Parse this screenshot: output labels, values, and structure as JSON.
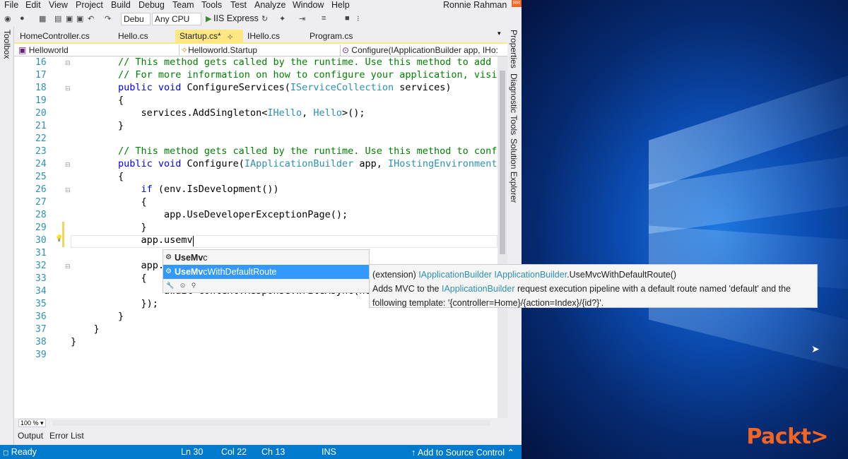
{
  "menu": [
    "File",
    "Edit",
    "View",
    "Project",
    "Build",
    "Debug",
    "Team",
    "Tools",
    "Test",
    "Analyze",
    "Window",
    "Help"
  ],
  "user": {
    "name": "Ronnie Rahman",
    "badge": "RR"
  },
  "toolbar": {
    "config": "Debu",
    "platform": "Any CPU",
    "run": "IIS Express"
  },
  "side_left": "Toolbox",
  "side_right": [
    "Properties",
    "Diagnostic Tools",
    "Solution Explorer"
  ],
  "tabs": [
    {
      "label": "HomeController.cs"
    },
    {
      "label": "Hello.cs"
    },
    {
      "label": "Startup.cs*",
      "active": true
    },
    {
      "label": "IHello.cs"
    },
    {
      "label": "Program.cs"
    }
  ],
  "nav": {
    "project": "Helloworld",
    "class": "Helloworld.Startup",
    "member": "Configure(IApplicationBuilder app, IHo:"
  },
  "lines": [
    "16",
    "17",
    "18",
    "19",
    "20",
    "21",
    "22",
    "23",
    "24",
    "25",
    "26",
    "27",
    "28",
    "29",
    "30",
    "31",
    "32",
    "33",
    "34",
    "35",
    "36",
    "37",
    "38",
    "39"
  ],
  "code": {
    "l16": "// This method gets called by the runtime. Use this method to add",
    "l17": "// For more information on how to configure your application, visi",
    "l18_kw": "public void ",
    "l18_fn": "ConfigureServices(",
    "l18_ty": "IServiceCollection",
    "l18_end": " services)",
    "l19": "{",
    "l20_a": "    services.AddSingleton<",
    "l20_t1": "IHello",
    "l20_b": ", ",
    "l20_t2": "Hello",
    "l20_c": ">();",
    "l21": "}",
    "l23": "// This method gets called by the runtime. Use this method to conf",
    "l24_kw": "public void ",
    "l24_fn": "Configure(",
    "l24_ty": "IApplicationBuilder",
    "l24_b": " app, ",
    "l24_ty2": "IHostingEnvironment",
    "l25": "{",
    "l26_kw": "    if",
    "l26_b": " (env.IsDevelopment())",
    "l27": "    {",
    "l28": "        app.UseDeveloperExceptionPage();",
    "l29": "    }",
    "l30": "    app.usemv",
    "l32": "    app.",
    "l33": "    {",
    "l34": "        await context.Response.WriteAsync(he",
    "l35": "    });",
    "l36": "}",
    "l37": "    }",
    "l38": "}"
  },
  "intellisense": {
    "items": [
      {
        "bold": "UseMv",
        "rest": "c"
      },
      {
        "bold": "UseMv",
        "rest": "cWithDefaultRoute",
        "selected": true
      }
    ]
  },
  "tooltip": {
    "line1_pre": "(extension) ",
    "line1_type": "IApplicationBuilder IApplicationBuilder",
    "line1_post": ".UseMvcWithDefaultRoute()",
    "line2_pre": "Adds MVC to the ",
    "line2_type": "IApplicationBuilder",
    "line2_post": " request execution pipeline with a default route named 'default' and the",
    "line3": "following template: '{controller=Home}/{action=Index}/{id?}'."
  },
  "zoom": "100 %",
  "bottom_tabs": [
    "Output",
    "Error List"
  ],
  "status": {
    "ready": "Ready",
    "ln": "Ln 30",
    "col": "Col 22",
    "ch": "Ch 13",
    "ins": "INS",
    "source_control": "↑ Add to Source Control ⌃"
  },
  "brand": "Packt>"
}
